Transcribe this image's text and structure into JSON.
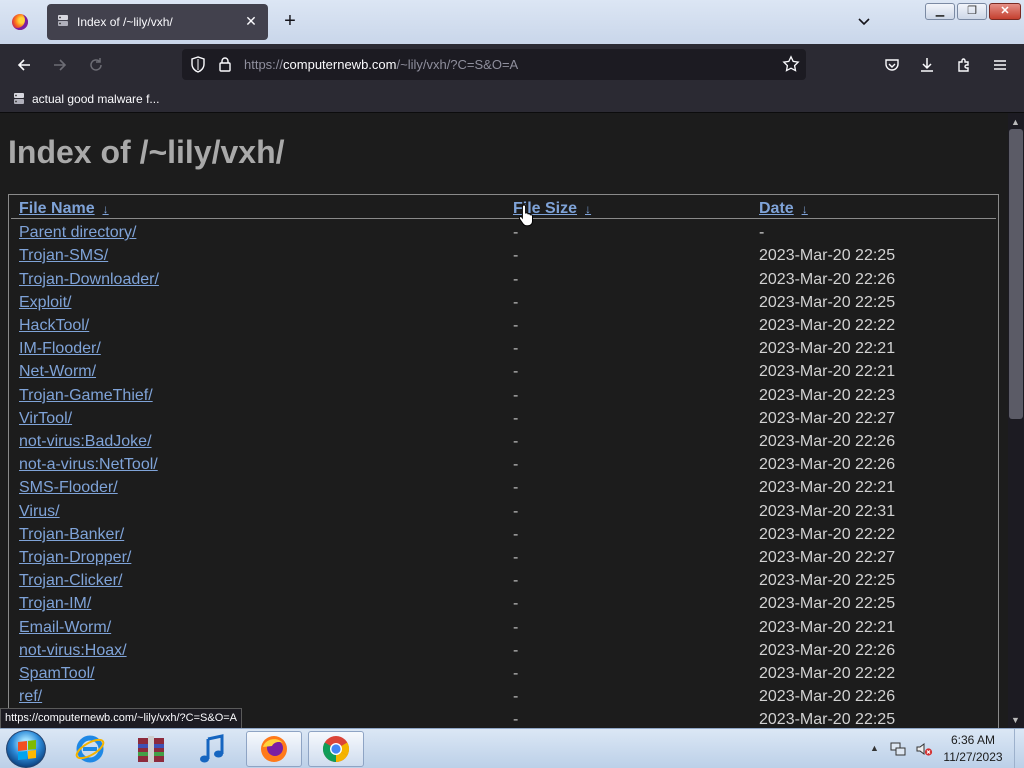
{
  "browser": {
    "tab": {
      "title": "Index of /~lily/vxh/",
      "close_glyph": "✕"
    },
    "new_tab_glyph": "+",
    "url": {
      "prefix": "https://",
      "host": "computernewb.com",
      "path": "/~lily/vxh/?C=S&O=A"
    },
    "bookmark": {
      "label": "actual good malware f..."
    },
    "window_buttons": {
      "minimize": "▁",
      "restore": "❐",
      "close": "✕"
    },
    "status_link": "https://computernewb.com/~lily/vxh/?C=S&O=A"
  },
  "page": {
    "title": "Index of /~lily/vxh/",
    "columns": {
      "name": "File Name",
      "size": "File Size",
      "date": "Date",
      "sort_arrow": "↓"
    },
    "rows": [
      {
        "name": "Parent directory/",
        "size": "-",
        "date": "-"
      },
      {
        "name": "Trojan-SMS/",
        "size": "-",
        "date": "2023-Mar-20 22:25"
      },
      {
        "name": "Trojan-Downloader/",
        "size": "-",
        "date": "2023-Mar-20 22:26"
      },
      {
        "name": "Exploit/",
        "size": "-",
        "date": "2023-Mar-20 22:25"
      },
      {
        "name": "HackTool/",
        "size": "-",
        "date": "2023-Mar-20 22:22"
      },
      {
        "name": "IM-Flooder/",
        "size": "-",
        "date": "2023-Mar-20 22:21"
      },
      {
        "name": "Net-Worm/",
        "size": "-",
        "date": "2023-Mar-20 22:21"
      },
      {
        "name": "Trojan-GameThief/",
        "size": "-",
        "date": "2023-Mar-20 22:23"
      },
      {
        "name": "VirTool/",
        "size": "-",
        "date": "2023-Mar-20 22:27"
      },
      {
        "name": "not-virus:BadJoke/",
        "size": "-",
        "date": "2023-Mar-20 22:26"
      },
      {
        "name": "not-a-virus:NetTool/",
        "size": "-",
        "date": "2023-Mar-20 22:26"
      },
      {
        "name": "SMS-Flooder/",
        "size": "-",
        "date": "2023-Mar-20 22:21"
      },
      {
        "name": "Virus/",
        "size": "-",
        "date": "2023-Mar-20 22:31"
      },
      {
        "name": "Trojan-Banker/",
        "size": "-",
        "date": "2023-Mar-20 22:22"
      },
      {
        "name": "Trojan-Dropper/",
        "size": "-",
        "date": "2023-Mar-20 22:27"
      },
      {
        "name": "Trojan-Clicker/",
        "size": "-",
        "date": "2023-Mar-20 22:25"
      },
      {
        "name": "Trojan-IM/",
        "size": "-",
        "date": "2023-Mar-20 22:25"
      },
      {
        "name": "Email-Worm/",
        "size": "-",
        "date": "2023-Mar-20 22:21"
      },
      {
        "name": "not-virus:Hoax/",
        "size": "-",
        "date": "2023-Mar-20 22:26"
      },
      {
        "name": "SpamTool/",
        "size": "-",
        "date": "2023-Mar-20 22:22"
      },
      {
        "name": "ref/",
        "size": "-",
        "date": "2023-Mar-20 22:26"
      },
      {
        "name": "",
        "size": "-",
        "date": "2023-Mar-20 22:25"
      }
    ]
  },
  "taskbar": {
    "items": [
      "start-orb",
      "internet-explorer-icon",
      "archive-app-icon",
      "music-player-icon",
      "firefox-icon",
      "chrome-icon"
    ],
    "clock": {
      "time": "6:36 AM",
      "date": "11/27/2023"
    },
    "tray_expand_glyph": "▲"
  },
  "colors": {
    "link": "#7fa3d8",
    "page_bg": "#1c1c1c",
    "title_text": "#a9a9a9",
    "toolbar_bg": "#2b2a33",
    "tab_bg": "#42414d"
  }
}
